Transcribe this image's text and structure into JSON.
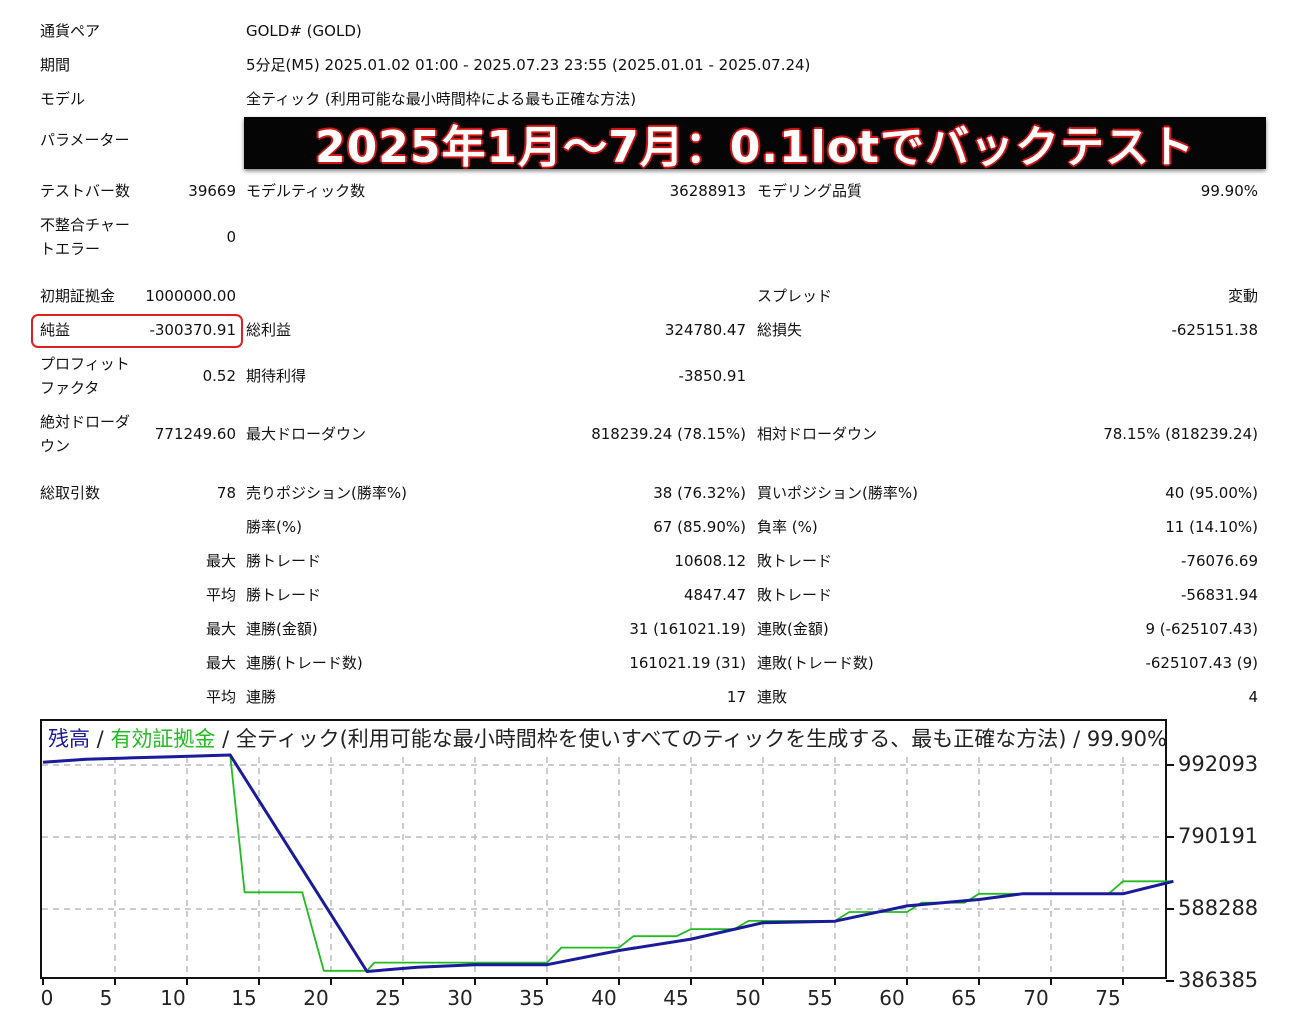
{
  "report": {
    "pair_label": "通貨ペア",
    "pair_value": "GOLD# (GOLD)",
    "period_label": "期間",
    "period_value": "5分足(M5) 2025.01.02 01:00 - 2025.07.23 23:55 (2025.01.01 - 2025.07.24)",
    "model_label": "モデル",
    "model_value": "全ティック (利用可能な最小時間枠による最も正確な方法)",
    "params_label": "パラメーター",
    "bars_label": "テストバー数",
    "bars_value": "39669",
    "ticks_label": "モデルティック数",
    "ticks_value": "36288913",
    "quality_label": "モデリング品質",
    "quality_value": "99.90%",
    "mismatch_label_1": "不整合チャー",
    "mismatch_label_2": "トエラー",
    "mismatch_value": "0",
    "deposit_label": "初期証拠金",
    "deposit_value": "1000000.00",
    "spread_label": "スプレッド",
    "spread_value": "変動",
    "net_label": "純益",
    "net_value": "-300370.91",
    "gross_profit_label": "総利益",
    "gross_profit_value": "324780.47",
    "gross_loss_label": "総損失",
    "gross_loss_value": "-625151.38",
    "pf_label_1": "プロフィット",
    "pf_label_2": "ファクタ",
    "pf_value": "0.52",
    "expected_label": "期待利得",
    "expected_value": "-3850.91",
    "abs_dd_label_1": "絶対ドローダ",
    "abs_dd_label_2": "ウン",
    "abs_dd_value": "771249.60",
    "max_dd_label": "最大ドローダウン",
    "max_dd_value": "818239.24 (78.15%)",
    "rel_dd_label": "相対ドローダウン",
    "rel_dd_value": "78.15% (818239.24)",
    "trades_label": "総取引数",
    "trades_value": "78",
    "short_label": "売りポジション(勝率%)",
    "short_value": "38 (76.32%)",
    "long_label": "買いポジション(勝率%)",
    "long_value": "40 (95.00%)",
    "win_rate_label": "勝率(%)",
    "win_rate_value": "67 (85.90%)",
    "loss_rate_label": "負率 (%)",
    "loss_rate_value": "11 (14.10%)",
    "max_label": "最大",
    "avg_label": "平均",
    "win_trade_label": "勝トレード",
    "loss_trade_label": "敗トレード",
    "max_win_value": "10608.12",
    "max_loss_value": "-76076.69",
    "avg_win_value": "4847.47",
    "avg_loss_value": "-56831.94",
    "consec_win_amt_label": "連勝(金額)",
    "consec_win_amt_value": "31 (161021.19)",
    "consec_loss_amt_label": "連敗(金額)",
    "consec_loss_amt_value": "9 (-625107.43)",
    "consec_win_cnt_label": "連勝(トレード数)",
    "consec_win_cnt_value": "161021.19 (31)",
    "consec_loss_cnt_label": "連敗(トレード数)",
    "consec_loss_cnt_value": "-625107.43 (9)",
    "avg_consec_win_label": "連勝",
    "avg_consec_win_value": "17",
    "avg_consec_loss_label": "連敗",
    "avg_consec_loss_value": "4"
  },
  "banner": {
    "text": "2025年1月～7月：0.1lotでバックテスト"
  },
  "colors": {
    "balance": "#1a1a9a",
    "equity": "#22bb22",
    "highlight": "#e02020",
    "grid": "#bbbbbb"
  },
  "chart_data": {
    "type": "line",
    "legend": {
      "balance": "残高",
      "sep1": " / ",
      "equity": "有効証拠金",
      "sep2": " / ",
      "model": "全ティック(利用可能な最小時間枠を使いすべてのティックを生成する、最も正確な方法) / 99.90%"
    },
    "y_ticks": [
      "992093",
      "790191",
      "588288",
      "386385"
    ],
    "x_ticks": [
      "0",
      "5",
      "10",
      "15",
      "20",
      "25",
      "30",
      "35",
      "40",
      "45",
      "50",
      "55",
      "60",
      "65",
      "70",
      "75"
    ],
    "ylim": [
      370000,
      1060000
    ],
    "xlim": [
      0,
      78.5
    ],
    "balance": [
      [
        0,
        1000000
      ],
      [
        3,
        1008000
      ],
      [
        6,
        1012000
      ],
      [
        9,
        1015000
      ],
      [
        13,
        1020000
      ],
      [
        22.5,
        413000
      ],
      [
        26,
        425000
      ],
      [
        30,
        432000
      ],
      [
        35,
        432000
      ],
      [
        40,
        472000
      ],
      [
        45,
        504000
      ],
      [
        50,
        550000
      ],
      [
        55,
        554000
      ],
      [
        60,
        597000
      ],
      [
        65,
        615000
      ],
      [
        68,
        631000
      ],
      [
        75,
        631000
      ],
      [
        78.5,
        666000
      ]
    ],
    "equity": [
      [
        0,
        1000000
      ],
      [
        3,
        1008000
      ],
      [
        6,
        1012000
      ],
      [
        9,
        1015000
      ],
      [
        13,
        1020000
      ],
      [
        14,
        635000
      ],
      [
        18,
        635000
      ],
      [
        19.5,
        415000
      ],
      [
        22.5,
        415000
      ],
      [
        23,
        438000
      ],
      [
        35,
        438000
      ],
      [
        36,
        480000
      ],
      [
        40,
        480000
      ],
      [
        41,
        512000
      ],
      [
        44,
        512000
      ],
      [
        45,
        532000
      ],
      [
        48,
        532000
      ],
      [
        49,
        555000
      ],
      [
        55,
        555000
      ],
      [
        56,
        580000
      ],
      [
        60,
        580000
      ],
      [
        61,
        606000
      ],
      [
        64,
        606000
      ],
      [
        65,
        631000
      ],
      [
        74,
        631000
      ],
      [
        75,
        666000
      ],
      [
        78.5,
        666000
      ]
    ]
  }
}
